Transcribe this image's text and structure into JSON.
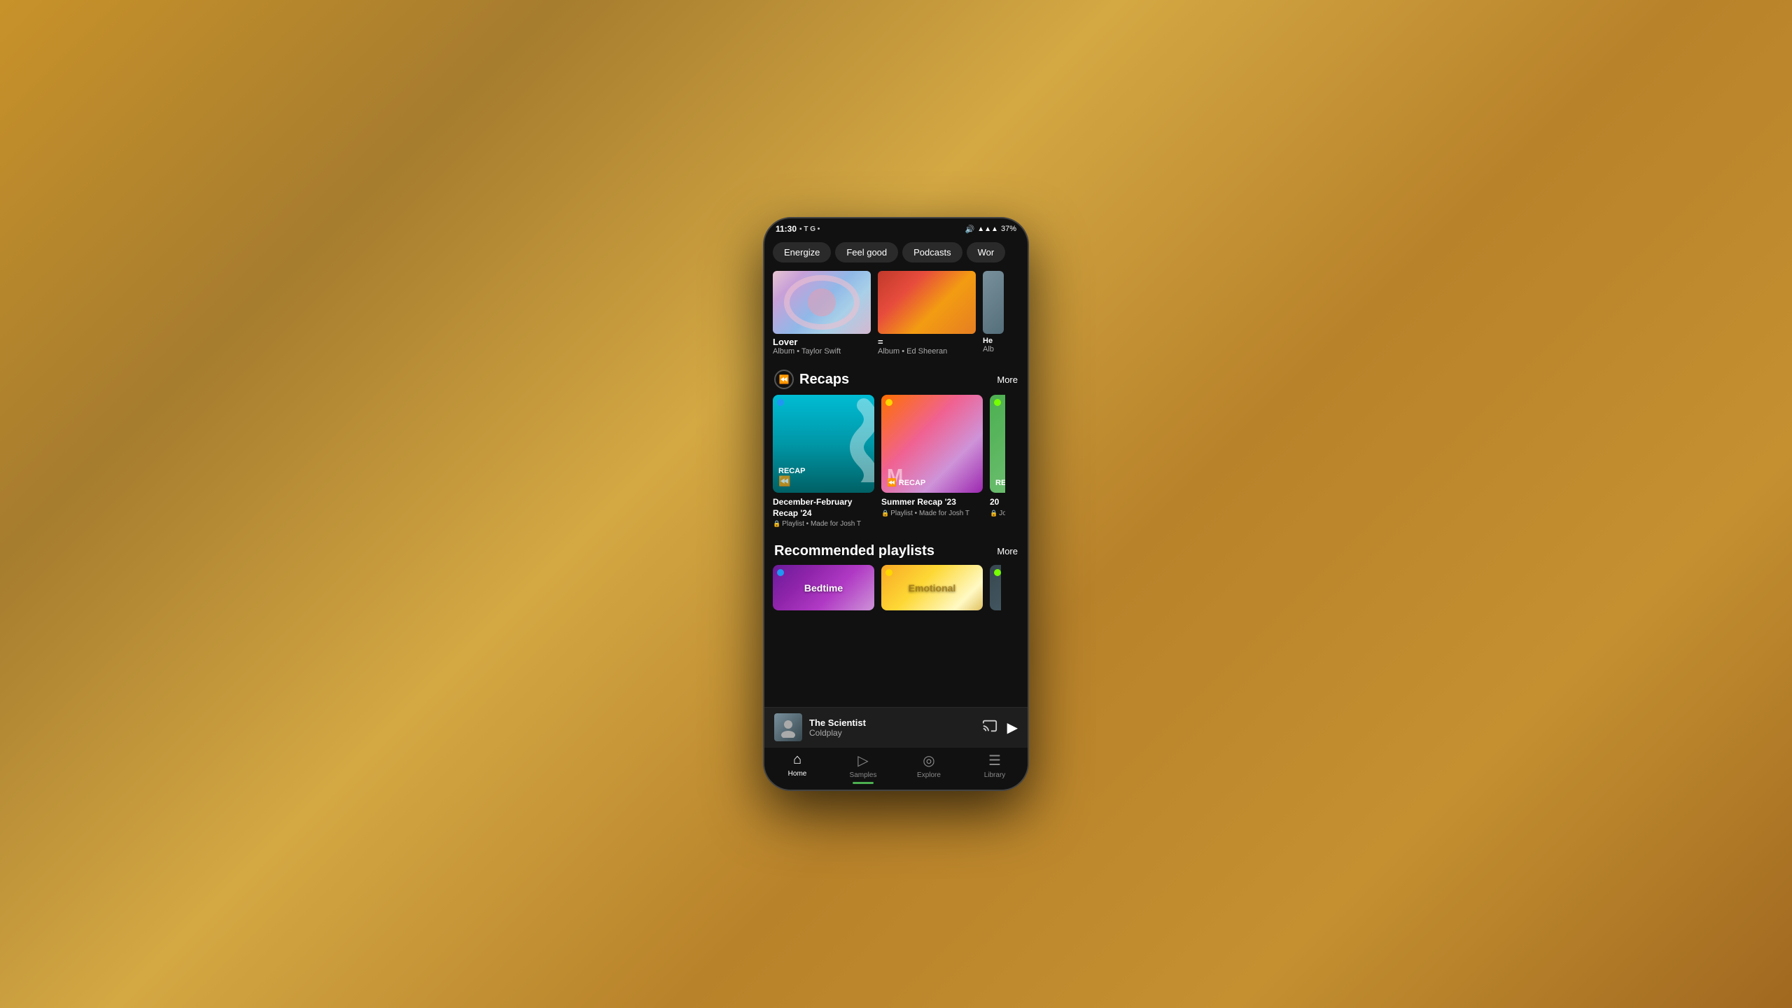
{
  "phone": {
    "status_bar": {
      "time": "11:30",
      "carrier_icons": "▪ T G •",
      "sound_icon": "🔊",
      "signal": "▲▲▲",
      "battery": "37%"
    },
    "tabs": [
      {
        "id": "energize",
        "label": "Energize",
        "active": false
      },
      {
        "id": "feel_good",
        "label": "Feel good",
        "active": false
      },
      {
        "id": "podcasts",
        "label": "Podcasts",
        "active": false
      },
      {
        "id": "workout",
        "label": "Wor",
        "active": false
      }
    ],
    "albums": [
      {
        "id": "lover",
        "title": "Lover",
        "subtitle": "Album • Taylor Swift",
        "type": "lover"
      },
      {
        "id": "equals",
        "title": "=",
        "subtitle": "Album • Ed Sheeran",
        "type": "ed"
      },
      {
        "id": "partial",
        "title": "He",
        "subtitle": "Alb",
        "type": "partial"
      }
    ],
    "recaps": {
      "section_title": "Recaps",
      "more_label": "More",
      "items": [
        {
          "id": "dec_feb",
          "title": "December-February Recap '24",
          "subtitle": "Playlist • Made for Josh T",
          "type": "blue"
        },
        {
          "id": "summer",
          "title": "Summer Recap '23",
          "subtitle": "Playlist • Made for Josh T",
          "type": "pink_orange"
        },
        {
          "id": "partial_recap",
          "title": "20",
          "subtitle": "Jos",
          "type": "partial"
        }
      ]
    },
    "recommended": {
      "section_title": "Recommended playlists",
      "more_label": "More",
      "items": [
        {
          "id": "bedtime",
          "label": "Bedtime",
          "type": "purple"
        },
        {
          "id": "emotional",
          "label": "Emotional",
          "type": "yellow"
        }
      ]
    },
    "now_playing": {
      "title": "The Scientist",
      "artist": "Coldplay"
    },
    "bottom_nav": [
      {
        "id": "home",
        "label": "Home",
        "icon": "⌂",
        "active": true
      },
      {
        "id": "samples",
        "label": "Samples",
        "icon": "▷",
        "active": false
      },
      {
        "id": "explore",
        "label": "Explore",
        "icon": "◎",
        "active": false
      },
      {
        "id": "library",
        "label": "Library",
        "icon": "☰",
        "active": false
      }
    ]
  }
}
